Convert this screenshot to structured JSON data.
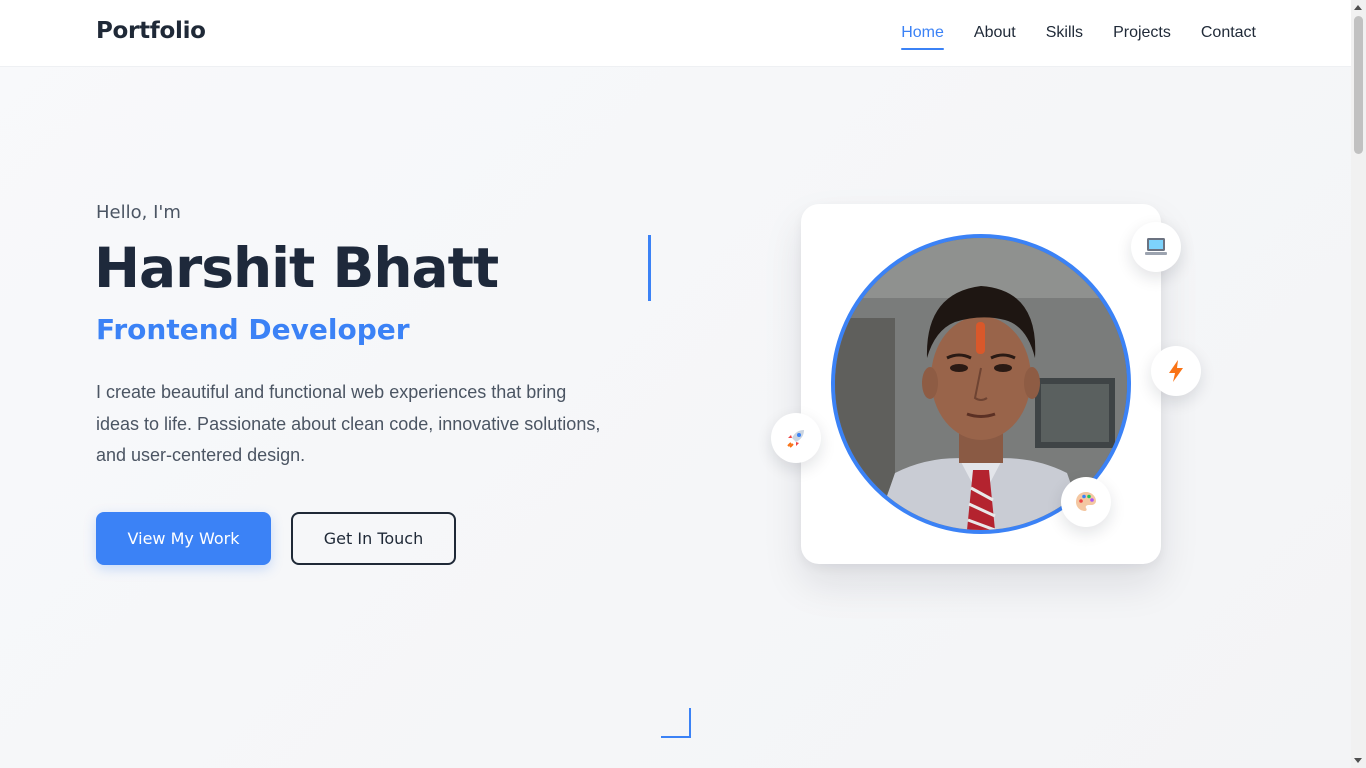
{
  "nav": {
    "brand": "Portfolio",
    "links": [
      {
        "label": "Home",
        "active": true
      },
      {
        "label": "About",
        "active": false
      },
      {
        "label": "Skills",
        "active": false
      },
      {
        "label": "Projects",
        "active": false
      },
      {
        "label": "Contact",
        "active": false
      }
    ]
  },
  "hero": {
    "greeting": "Hello, I'm",
    "name": "Harshit Bhatt",
    "role": "Frontend Developer",
    "description": "I create beautiful and functional web experiences that bring ideas to life. Passionate about clean code, innovative solutions, and user-centered design.",
    "primary_button": "View My Work",
    "secondary_button": "Get In Touch"
  },
  "profile_card": {
    "badges": [
      "laptop-icon",
      "lightning-icon",
      "rocket-icon",
      "palette-icon"
    ]
  },
  "colors": {
    "accent": "#3b82f6",
    "text_dark": "#1e293b",
    "text_muted": "#4b5563"
  }
}
